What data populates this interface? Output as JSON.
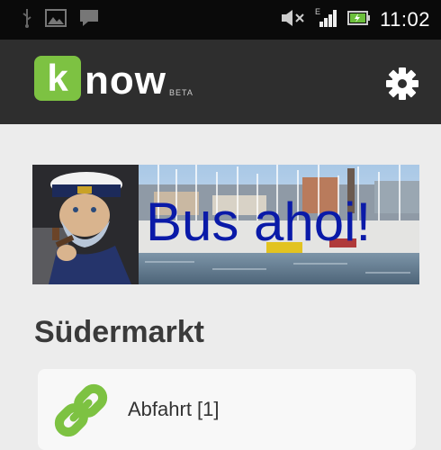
{
  "status_bar": {
    "time": "11:02",
    "icons": [
      "usb-icon",
      "image-notification-icon",
      "message-notification-icon",
      "mute-icon",
      "signal-edge-icon",
      "battery-charging-icon"
    ]
  },
  "app_bar": {
    "logo_letter": "k",
    "logo_rest": "now",
    "logo_beta": "BETA",
    "settings_icon": "gear-icon"
  },
  "banner": {
    "text": "Bus ahoi!"
  },
  "stop": {
    "name": "Südermarkt"
  },
  "departures": {
    "label": "Abfahrt [1]",
    "icon": "link-icon"
  },
  "colors": {
    "brand_green": "#7dc242",
    "app_bar": "#2e2e2e",
    "status_bar": "#0a0a0a",
    "background": "#ececec",
    "banner_text": "#0a1aa8"
  }
}
